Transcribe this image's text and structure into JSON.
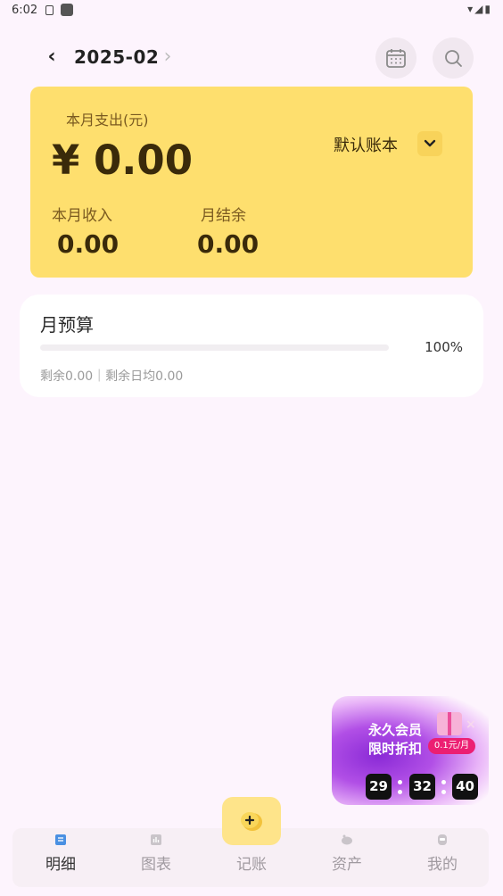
{
  "status_bar": {
    "time": "6:02"
  },
  "header": {
    "month": "2025-02"
  },
  "summary": {
    "expense_label": "本月支出(元)",
    "expense_amount": "¥ 0.00",
    "book_name": "默认账本",
    "income_label": "本月收入",
    "income_value": "0.00",
    "balance_label": "月结余",
    "balance_value": "0.00"
  },
  "budget": {
    "title": "月预算",
    "percent": "100%",
    "remaining_text": "剩余0.00｜剩余日均0.00",
    "progress_fraction": 1.0
  },
  "promo": {
    "line1": "永久会员",
    "line2": "限时折扣",
    "price": "0.1元/月",
    "hours": "29",
    "minutes": "32",
    "seconds": "40"
  },
  "bottom_nav": {
    "tabs": [
      {
        "label": "明细",
        "icon": "detail-list-icon",
        "active": true
      },
      {
        "label": "图表",
        "icon": "chart-icon",
        "active": false
      },
      {
        "label": "记账",
        "icon": "add-bubble-icon",
        "active": false
      },
      {
        "label": "资产",
        "icon": "piggy-bank-icon",
        "active": false
      },
      {
        "label": "我的",
        "icon": "profile-icon",
        "active": false
      }
    ]
  },
  "colors": {
    "background": "#fdf4fd",
    "card_yellow": "#fedf6e",
    "fab_yellow": "#fee48a",
    "active_icon_blue": "#4a90e2",
    "promo_purple": "#8a2ad6"
  }
}
